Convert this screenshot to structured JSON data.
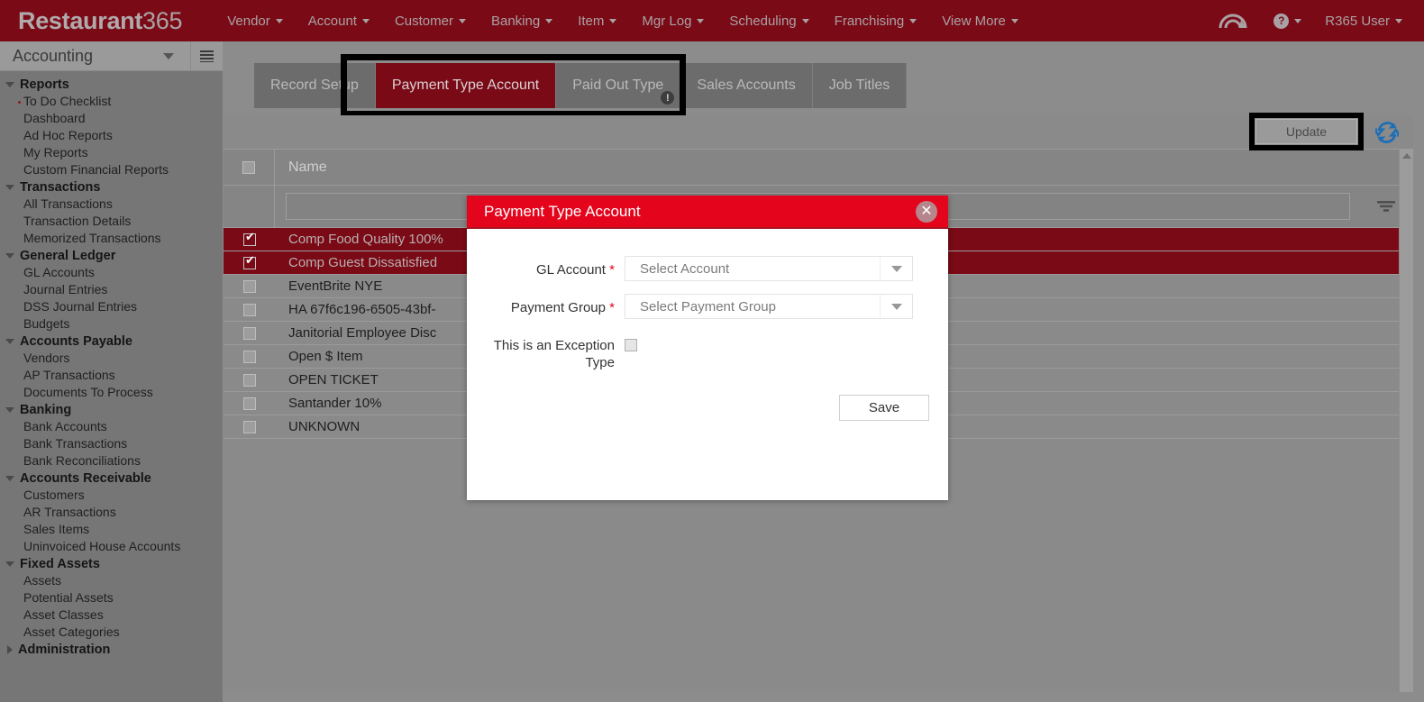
{
  "topnav": {
    "brand_bold": "Restaurant",
    "brand_light": "365",
    "items": [
      {
        "label": "Vendor"
      },
      {
        "label": "Account"
      },
      {
        "label": "Customer"
      },
      {
        "label": "Banking"
      },
      {
        "label": "Item"
      },
      {
        "label": "Mgr Log"
      },
      {
        "label": "Scheduling"
      },
      {
        "label": "Franchising"
      },
      {
        "label": "View More"
      }
    ],
    "help_glyph": "?",
    "user_label": "R365 User"
  },
  "sidebar": {
    "context": "Accounting",
    "groups": [
      {
        "label": "Reports",
        "expanded": true,
        "items": [
          {
            "label": "To Do Checklist",
            "dot": true
          },
          {
            "label": "Dashboard"
          },
          {
            "label": "Ad Hoc Reports"
          },
          {
            "label": "My Reports"
          },
          {
            "label": "Custom Financial Reports"
          }
        ]
      },
      {
        "label": "Transactions",
        "expanded": true,
        "items": [
          {
            "label": "All Transactions"
          },
          {
            "label": "Transaction Details"
          },
          {
            "label": "Memorized Transactions"
          }
        ]
      },
      {
        "label": "General Ledger",
        "expanded": true,
        "items": [
          {
            "label": "GL Accounts"
          },
          {
            "label": "Journal Entries"
          },
          {
            "label": "DSS Journal Entries"
          },
          {
            "label": "Budgets"
          }
        ]
      },
      {
        "label": "Accounts Payable",
        "expanded": true,
        "items": [
          {
            "label": "Vendors"
          },
          {
            "label": "AP Transactions"
          },
          {
            "label": "Documents To Process"
          }
        ]
      },
      {
        "label": "Banking",
        "expanded": true,
        "items": [
          {
            "label": "Bank Accounts"
          },
          {
            "label": "Bank Transactions"
          },
          {
            "label": "Bank Reconciliations"
          }
        ]
      },
      {
        "label": "Accounts Receivable",
        "expanded": true,
        "items": [
          {
            "label": "Customers"
          },
          {
            "label": "AR Transactions"
          },
          {
            "label": "Sales Items"
          },
          {
            "label": "Uninvoiced House Accounts"
          }
        ]
      },
      {
        "label": "Fixed Assets",
        "expanded": true,
        "items": [
          {
            "label": "Assets"
          },
          {
            "label": "Potential Assets"
          },
          {
            "label": "Asset Classes"
          },
          {
            "label": "Asset Categories"
          }
        ]
      },
      {
        "label": "Administration",
        "expanded": false,
        "items": []
      }
    ]
  },
  "tabs": [
    {
      "label": "Record Setup",
      "active": false,
      "warn": false
    },
    {
      "label": "Payment Type Account",
      "active": true,
      "warn": false
    },
    {
      "label": "Paid Out Type",
      "active": false,
      "warn": true
    },
    {
      "label": "Sales Accounts",
      "active": false,
      "warn": false
    },
    {
      "label": "Job Titles",
      "active": false,
      "warn": false
    }
  ],
  "toolbar": {
    "update_label": "Update",
    "refresh_icon": "refresh-icon"
  },
  "grid": {
    "column_header": "Name",
    "filter_value": "",
    "rows": [
      {
        "name": "Comp Food Quality 100%",
        "selected": true
      },
      {
        "name": "Comp Guest Dissatisfied",
        "selected": true
      },
      {
        "name": "EventBrite NYE",
        "selected": false
      },
      {
        "name": "HA 67f6c196-6505-43bf-",
        "selected": false
      },
      {
        "name": "Janitorial Employee Disc",
        "selected": false
      },
      {
        "name": "Open $ Item",
        "selected": false
      },
      {
        "name": "OPEN TICKET",
        "selected": false
      },
      {
        "name": "Santander 10%",
        "selected": false
      },
      {
        "name": "UNKNOWN",
        "selected": false
      }
    ]
  },
  "modal": {
    "title": "Payment Type Account",
    "close_glyph": "✕",
    "fields": {
      "gl_account": {
        "label": "GL Account",
        "required_marker": "*",
        "value": "Select Account"
      },
      "payment_group": {
        "label": "Payment Group",
        "required_marker": "*",
        "value": "Select Payment Group"
      },
      "exception_type": {
        "label": "This is an Exception Type",
        "checked": false
      }
    },
    "save_label": "Save"
  },
  "colors": {
    "brand_red": "#7a0a16",
    "modal_red": "#e4041c",
    "required_red": "#e4041c",
    "refresh_blue": "#1f6fb5",
    "focus_ring": "#000000"
  }
}
